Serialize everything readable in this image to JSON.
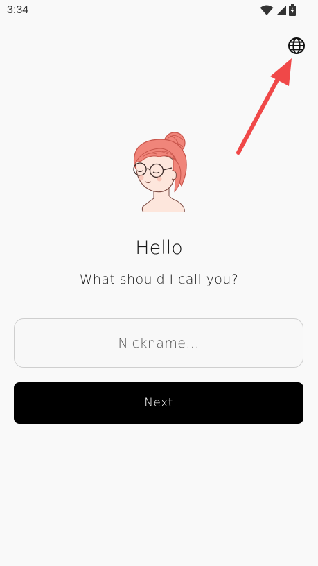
{
  "status_bar": {
    "time": "3:34",
    "icons": [
      "wifi-icon",
      "cell-signal-icon",
      "battery-charging-icon"
    ]
  },
  "header": {
    "language_icon": "globe-icon"
  },
  "annotation": {
    "arrow_color": "#f04848"
  },
  "avatar": {
    "icon": "girl-avatar-illustration"
  },
  "main": {
    "greeting": "Hello",
    "prompt": "What should I call you?",
    "nickname": {
      "value": "",
      "placeholder": "Nickname..."
    },
    "next_label": "Next"
  },
  "colors": {
    "background": "#f9f9f9",
    "button_bg": "#000000",
    "button_text": "#ffffff",
    "hair": "#f0857a",
    "skin": "#fde6dc"
  }
}
